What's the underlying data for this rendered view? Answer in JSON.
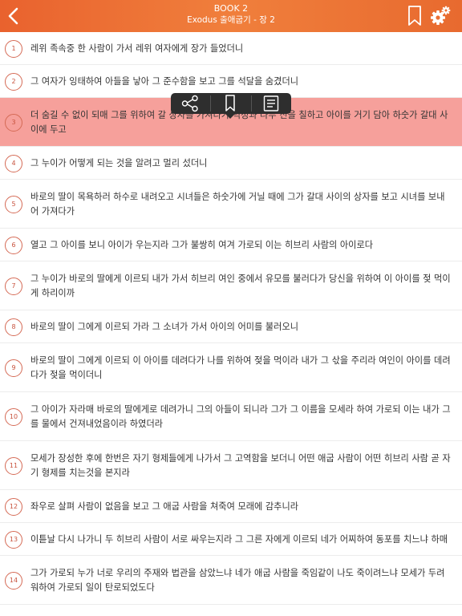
{
  "header": {
    "book": "BOOK 2",
    "chapter_title": "Exodus 출애굽기 - 장 2",
    "back_icon": "chevron-left-icon",
    "bookmark_icon": "bookmark-icon",
    "settings_icon": "gear-icon",
    "accent_color": "#ec6f33"
  },
  "popup": {
    "share_icon": "share-icon",
    "bookmark_icon": "bookmark-icon",
    "note_icon": "note-icon"
  },
  "verses": [
    {
      "num": "1",
      "lines": [
        "레위 족속중 한 사람이 가서 레위 여자에게 장가 들었더니"
      ]
    },
    {
      "num": "2",
      "lines": [
        "그 여자가 잉태하여 아들을 낳아 그 준수함을 보고 그를 석달을 숨겼더니"
      ]
    },
    {
      "num": "3",
      "selected": true,
      "lines": [
        "더 숨길 수 없이 되매 그를 위하여 갈 상자를 가져다가 역청과 나무 진을 칠하고 아이를 거기 담아 하숫가 갈대 사",
        "이에 두고"
      ]
    },
    {
      "num": "4",
      "lines": [
        "그 누이가 어떻게 되는 것을 알려고 멀리 섰더니"
      ]
    },
    {
      "num": "5",
      "lines": [
        "바로의 딸이 목욕하러 하수로 내려오고 시녀들은 하숫가에 거닐 때에 그가 갈대 사이의 상자를 보고 시녀를 보내",
        "어 가져다가"
      ]
    },
    {
      "num": "6",
      "lines": [
        "열고 그 아이를 보니 아이가 우는지라 그가 불쌍히 여겨 가로되 이는 히브리 사람의 아이로다"
      ]
    },
    {
      "num": "7",
      "lines": [
        "그 누이가 바로의 딸에게 이르되 내가 가서 히브리 여인 중에서 유모를 불러다가 당신을 위하여 이 아이를 젖 먹이",
        "게 하리이까"
      ]
    },
    {
      "num": "8",
      "lines": [
        "바로의 딸이 그에게 이르되 가라 그 소녀가 가서 아이의 어미를 불러오니"
      ]
    },
    {
      "num": "9",
      "lines": [
        "바로의 딸이 그에게 이르되 이 아이를 데려다가 나를 위하여 젖을 먹이라 내가 그 삯을 주리라 여인이 아이를 데려",
        "다가 젖을 먹이더니"
      ]
    },
    {
      "num": "10",
      "lines": [
        "그 아이가 자라매 바로의 딸에게로 데려가니 그의 아들이 되니라 그가 그 이름을 모세라 하여 가로되 이는 내가 그",
        "를 물에서 건져내었음이라 하였더라"
      ]
    },
    {
      "num": "11",
      "lines": [
        "모세가 장성한 후에 한번은 자기 형제들에게 나가서 그 고역함을 보더니 어떤 애굽 사람이 어떤 히브리 사람 곧 자",
        "기 형제를 치는것을 본지라"
      ]
    },
    {
      "num": "12",
      "lines": [
        "좌우로 살펴 사람이 없음을 보고 그 애굽 사람을 쳐죽여 모래에 감추니라"
      ]
    },
    {
      "num": "13",
      "lines": [
        "이튿날 다시 나가니 두 히브리 사람이 서로 싸우는지라 그 그른 자에게 이르되 네가 어찌하여 동포를 치느냐 하매"
      ]
    },
    {
      "num": "14",
      "lines": [
        "그가 가로되 누가 너로 우리의 주재와 법관을 삼았느냐 네가 애굽 사람을 죽임같이 나도 죽이려느냐 모세가 두려",
        "워하여 가로되 일이 탄로되었도다"
      ]
    }
  ]
}
